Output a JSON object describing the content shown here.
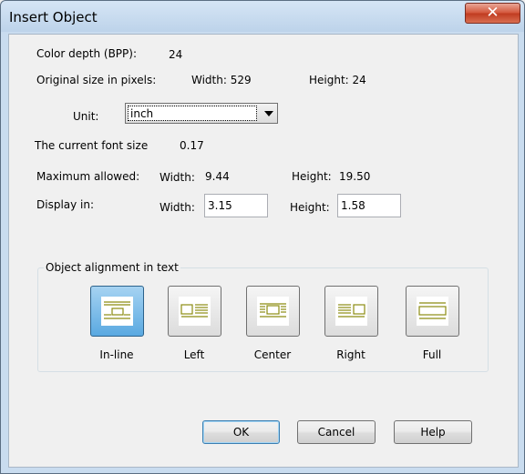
{
  "window": {
    "title": "Insert Object",
    "close_glyph": "✕"
  },
  "color_depth": {
    "label": "Color depth (BPP):",
    "value": "24"
  },
  "original_size": {
    "label": "Original size in pixels:",
    "width_text": "Width:  529",
    "height_text": "Height:  24"
  },
  "unit": {
    "label": "Unit:",
    "selected": "inch"
  },
  "font_size": {
    "label": "The current font size",
    "value": "0.17"
  },
  "maximum": {
    "label": "Maximum allowed:",
    "width_label": "Width:",
    "width_value": "9.44",
    "height_label": "Height:",
    "height_value": "19.50"
  },
  "display": {
    "label": "Display in:",
    "width_label": "Width:",
    "width_value": "3.15",
    "height_label": "Height:",
    "height_value": "1.58"
  },
  "alignment": {
    "title": "Object alignment in text",
    "icon_color": "#8c8c12",
    "options": [
      {
        "label": "In-line",
        "selected": true
      },
      {
        "label": "Left",
        "selected": false
      },
      {
        "label": "Center",
        "selected": false
      },
      {
        "label": "Right",
        "selected": false
      },
      {
        "label": "Full",
        "selected": false
      }
    ]
  },
  "buttons": {
    "ok": "OK",
    "cancel": "Cancel",
    "help": "Help"
  }
}
